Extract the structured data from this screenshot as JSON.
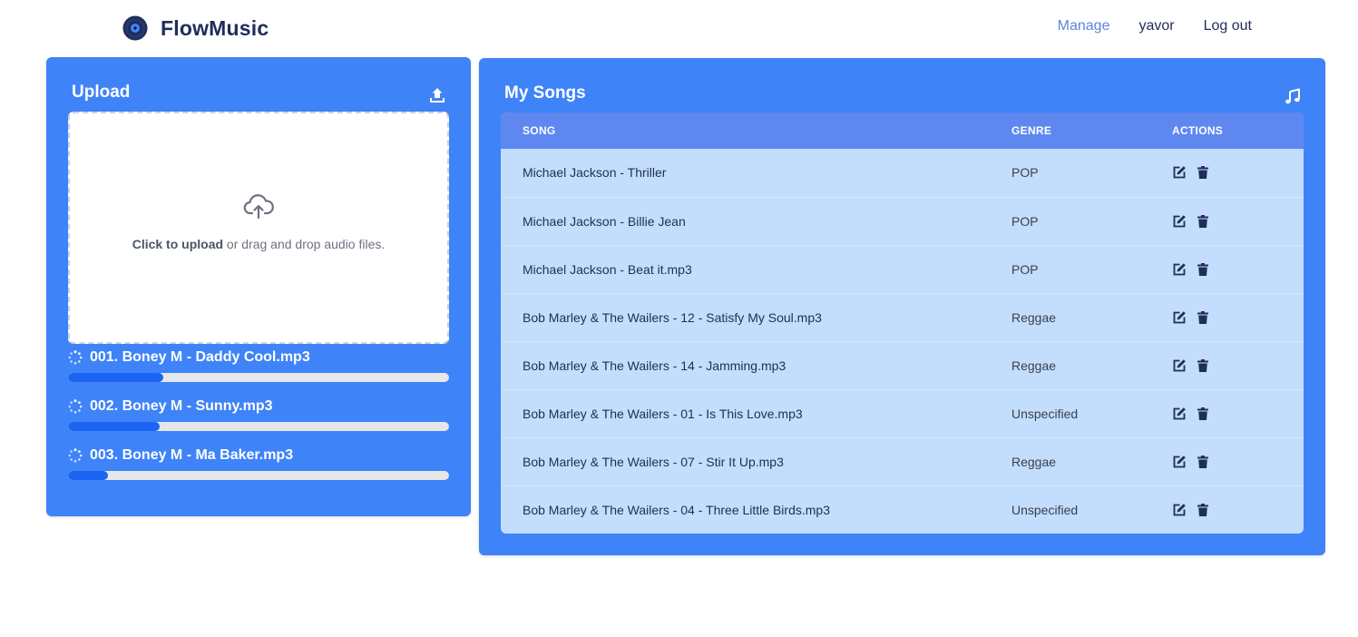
{
  "header": {
    "brand": "FlowMusic",
    "nav": {
      "manage": "Manage",
      "user": "yavor",
      "logout": "Log out"
    }
  },
  "upload": {
    "title": "Upload",
    "dropzone": {
      "strong": "Click to upload",
      "rest": " or drag and drop audio files."
    },
    "items": [
      {
        "name": "001. Boney M - Daddy Cool.mp3",
        "progress": 0.25
      },
      {
        "name": "002. Boney M - Sunny.mp3",
        "progress": 0.24
      },
      {
        "name": "003. Boney M - Ma Baker.mp3",
        "progress": 0.105
      }
    ]
  },
  "songs": {
    "title": "My Songs",
    "columns": {
      "song": "Song",
      "genre": "Genre",
      "actions": "Actions"
    },
    "rows": [
      {
        "song": "Michael Jackson - Thriller",
        "genre": "POP"
      },
      {
        "song": "Michael Jackson - Billie Jean",
        "genre": "POP"
      },
      {
        "song": "Michael Jackson - Beat it.mp3",
        "genre": "POP"
      },
      {
        "song": "Bob Marley & The Wailers - 12 - Satisfy My Soul.mp3",
        "genre": "Reggae"
      },
      {
        "song": "Bob Marley & The Wailers - 14 - Jamming.mp3",
        "genre": "Reggae"
      },
      {
        "song": "Bob Marley & The Wailers - 01 - Is This Love.mp3",
        "genre": "Unspecified"
      },
      {
        "song": "Bob Marley & The Wailers - 07 - Stir It Up.mp3",
        "genre": "Reggae"
      },
      {
        "song": "Bob Marley & The Wailers - 04 - Three Little Birds.mp3",
        "genre": "Unspecified"
      }
    ]
  },
  "colors": {
    "panel": "#3f83f8",
    "table_header": "#5e88f0",
    "table_body": "#c3ddfd",
    "progress_fill": "#1c64f2",
    "nav_active": "#5a86d9",
    "brand_text": "#1f2d5a"
  },
  "icons": {
    "brand_logo": "vinyl-record-icon",
    "upload": "upload-icon",
    "dropzone": "cloud-upload-icon",
    "spinner": "spinner-icon",
    "songs": "music-note-icon",
    "edit": "edit-icon",
    "delete": "trash-icon"
  }
}
